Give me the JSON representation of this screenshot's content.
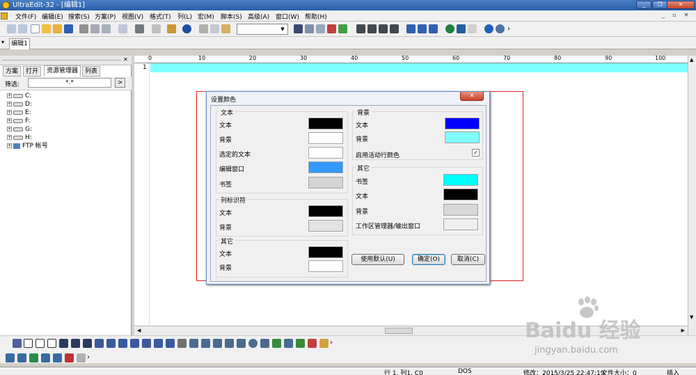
{
  "window": {
    "title": "UltraEdit-32 - [编辑1]",
    "minimize": "_",
    "restore": "❐",
    "close": "✕"
  },
  "menu": [
    "文件(F)",
    "编辑(E)",
    "搜索(S)",
    "方案(P)",
    "视图(V)",
    "格式(T)",
    "列(L)",
    "宏(M)",
    "脚本(S)",
    "高级(A)",
    "窗口(W)",
    "帮助(H)"
  ],
  "mdi_controls": {
    "minimize": "_",
    "restore": "▫",
    "close": "✕"
  },
  "toolbar": {
    "overflow": "›"
  },
  "doc_tab": {
    "label": "编辑1"
  },
  "panel": {
    "tabs": [
      "方案",
      "打开",
      "资源管理器",
      "列表"
    ],
    "filter_label": "筛选:",
    "filter_value": "*.*",
    "filter_button": ">",
    "tree": [
      {
        "label": "C:",
        "type": "drive"
      },
      {
        "label": "D:",
        "type": "drive"
      },
      {
        "label": "E:",
        "type": "drive"
      },
      {
        "label": "F:",
        "type": "drive"
      },
      {
        "label": "G:",
        "type": "drive"
      },
      {
        "label": "H:",
        "type": "drive"
      },
      {
        "label": "FTP 帐号",
        "type": "ftp"
      }
    ]
  },
  "editor": {
    "ruler": [
      "0",
      "10",
      "20",
      "30",
      "40",
      "50",
      "60",
      "70",
      "80",
      "90",
      "100"
    ],
    "line_number": "1",
    "active_line_color": "#80ffff"
  },
  "dialog": {
    "title": "设置颜色",
    "close_label": "✕",
    "left": {
      "text_group": {
        "title": "文本",
        "rows": [
          {
            "label": "文本",
            "color": "#000000"
          },
          {
            "label": "背景",
            "color": "#ffffff"
          },
          {
            "label": "选定的文本",
            "color": "#ffffff"
          },
          {
            "label": "编辑窗口",
            "color": "#3399ff"
          },
          {
            "label": "书签",
            "color": "#d4d4d4"
          }
        ]
      },
      "column_group": {
        "title": "列标识符",
        "rows": [
          {
            "label": "文本",
            "color": "#000000"
          },
          {
            "label": "背景",
            "color": "#e3e3e3"
          }
        ]
      },
      "other_group": {
        "title": "其它",
        "rows": [
          {
            "label": "文本",
            "color": "#000000"
          },
          {
            "label": "背景",
            "color": "#ffffff"
          }
        ]
      }
    },
    "right": {
      "bg_group": {
        "title": "背景",
        "rows": [
          {
            "label": "文本",
            "color": "#0000ff"
          },
          {
            "label": "背景",
            "color": "#80ffff"
          }
        ],
        "checkbox_label": "启用活动行颜色",
        "checkbox_mark": "✓",
        "checkbox_checked": true
      },
      "other_group": {
        "title": "其它",
        "rows": [
          {
            "label": "书签",
            "color": "#00ffff"
          },
          {
            "label": "文本",
            "color": "#000000"
          },
          {
            "label": "背景",
            "color": "#d8d8d8"
          },
          {
            "label": "工作区管理器/输出窗口",
            "color": "#f0f0f0"
          }
        ]
      }
    },
    "buttons": {
      "default": "使用默认(U)",
      "ok": "确定(O)",
      "cancel": "取消(C)"
    }
  },
  "status": {
    "position": "行 1, 列1, C0",
    "format": "DOS",
    "modified": "修改：2015/3/25 22:47:19",
    "filesize": "文件大小：0",
    "mode": "插入"
  },
  "watermark": {
    "brand": "Baidu 经验",
    "url": "jingyan.baidu.com"
  }
}
